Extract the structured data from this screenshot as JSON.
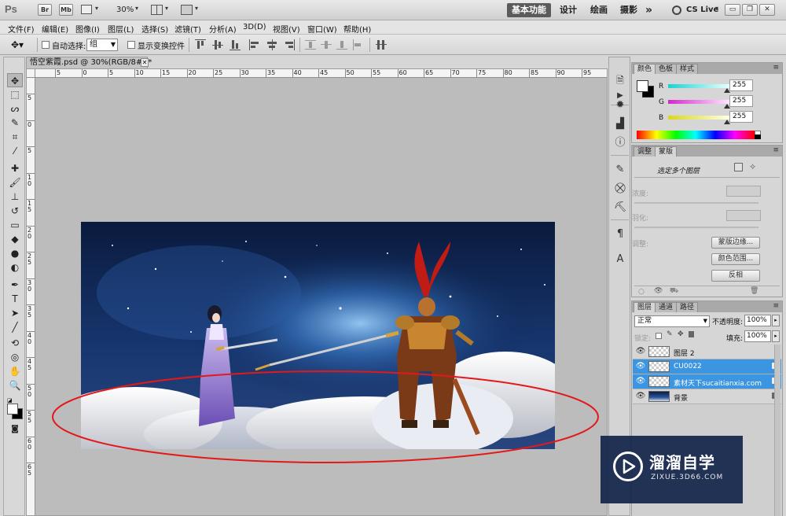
{
  "appbar": {
    "app_logo": "Ps",
    "br_label": "Br",
    "mb_label": "Mb",
    "zoom": "30%",
    "workspaces": [
      "基本功能",
      "设计",
      "绘画",
      "摄影"
    ],
    "more": "»",
    "cs_live": "CS Live"
  },
  "menu": [
    "文件(F)",
    "编辑(E)",
    "图像(I)",
    "图层(L)",
    "选择(S)",
    "滤镜(T)",
    "分析(A)",
    "3D(D)",
    "视图(V)",
    "窗口(W)",
    "帮助(H)"
  ],
  "options": {
    "auto_select_label": "自动选择:",
    "auto_select_value": "组",
    "show_transform_label": "显示变换控件"
  },
  "document": {
    "tab_title": "悟空紫霞.psd @ 30%(RGB/8#) *",
    "ruler_h": [
      "5",
      "0",
      "5",
      "10",
      "15",
      "20",
      "25",
      "30",
      "35",
      "40",
      "45",
      "50",
      "55",
      "60",
      "65",
      "70",
      "75",
      "80",
      "85",
      "90",
      "95"
    ],
    "ruler_v": [
      "5",
      "0",
      "5",
      "10",
      "15",
      "20",
      "25",
      "30",
      "35",
      "40",
      "45",
      "50",
      "55",
      "60",
      "65"
    ]
  },
  "color_panel": {
    "tabs": [
      "颜色",
      "色板",
      "样式"
    ],
    "channels": [
      {
        "label": "R",
        "value": "255",
        "color": "#19e0e6"
      },
      {
        "label": "G",
        "value": "255",
        "color": "#e02ed8"
      },
      {
        "label": "B",
        "value": "255",
        "color": "#e0e019"
      }
    ]
  },
  "adjust_panel": {
    "tabs": [
      "调整",
      "蒙版"
    ],
    "selection_text": "选定多个图层",
    "density_label": "浓度:",
    "feather_label": "羽化:",
    "refine_label": "调整:",
    "buttons": [
      "蒙版边缘...",
      "颜色范围...",
      "反相"
    ]
  },
  "layers_panel": {
    "tabs": [
      "图层",
      "通道",
      "路径"
    ],
    "blend_mode": "正常",
    "opacity_label": "不透明度:",
    "opacity_value": "100%",
    "lock_label": "锁定:",
    "fill_label": "填充:",
    "fill_value": "100%",
    "layers": [
      {
        "name": "图层 2",
        "selected": false
      },
      {
        "name": "CU0022",
        "selected": true
      },
      {
        "name": "素材天下sucaitianxia.com",
        "selected": true
      },
      {
        "name": "背景",
        "selected": false
      }
    ]
  },
  "watermark": {
    "title": "溜溜自学",
    "subtitle": "ZIXUE.3D66.COM"
  },
  "annotation_color": "#e3181b",
  "accent": "#3c95e0"
}
